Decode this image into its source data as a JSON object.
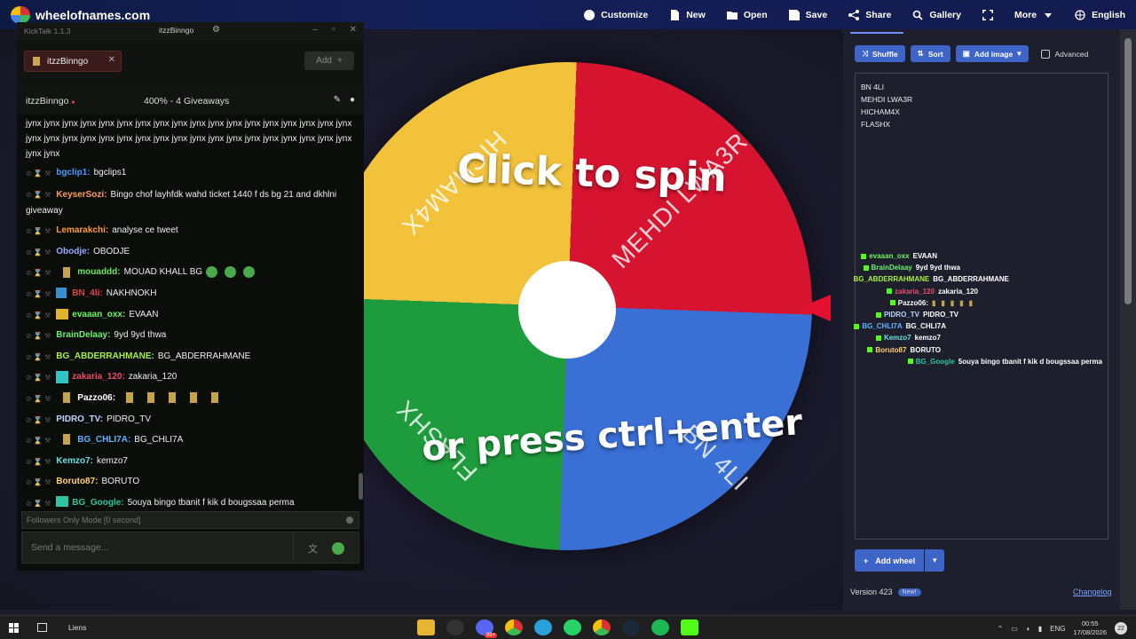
{
  "site": {
    "logo_text": "wheelofnames.com"
  },
  "topmenu": [
    {
      "label": "Customize",
      "icon": "palette-icon"
    },
    {
      "label": "New",
      "icon": "file-icon"
    },
    {
      "label": "Open",
      "icon": "folder-icon"
    },
    {
      "label": "Save",
      "icon": "save-icon"
    },
    {
      "label": "Share",
      "icon": "share-icon"
    },
    {
      "label": "Gallery",
      "icon": "search-icon"
    },
    {
      "label": "",
      "icon": "fullscreen-icon"
    },
    {
      "label": "More",
      "icon": "chevron-down-icon"
    },
    {
      "label": "English",
      "icon": "globe-icon"
    }
  ],
  "wheel": {
    "segments": [
      {
        "label": "MEHDI LWA3R",
        "color": "#d7142f"
      },
      {
        "label": "BN 4LI",
        "color": "#3a6fd6"
      },
      {
        "label": "FLASHX",
        "color": "#1e9b3d"
      },
      {
        "label": "HICHAM4X",
        "color": "#f2c23a"
      }
    ],
    "spin_top": "Click to spin",
    "spin_bottom": "or press ctrl+enter"
  },
  "panel": {
    "shuffle": "Shuffle",
    "sort": "Sort",
    "add_image": "Add image",
    "advanced": "Advanced",
    "entries": [
      "BN 4LI",
      "MEHDI LWA3R",
      "HICHAM4X",
      "FLASHX"
    ],
    "add_wheel": "Add wheel",
    "version": "Version 423",
    "new_badge": "New!",
    "changelog": "Changelog"
  },
  "overlay": [
    {
      "user": "evaaan_oxx",
      "msg": "EVAAN",
      "color": "#6cf55a"
    },
    {
      "user": "BrainDelaay",
      "msg": "9yd 9yd thwa",
      "color": "#6ff06f"
    },
    {
      "user": "BG_ABDERRAHMANE",
      "msg": "BG_ABDERRAHMANE",
      "color": "#a6f23a"
    },
    {
      "user": "zakaria_120",
      "msg": "zakaria_120",
      "color": "#ea4e6a"
    },
    {
      "user": "Pazzo06:",
      "msg": "",
      "color": "#ffffff"
    },
    {
      "user": "PIDRO_TV",
      "msg": "PIDRO_TV",
      "color": "#bcd4ff"
    },
    {
      "user": "BG_CHLI7A",
      "msg": "BG_CHLI7A",
      "color": "#5fb3ff"
    },
    {
      "user": "Kemzo7",
      "msg": "kemzo7",
      "color": "#66e0e0"
    },
    {
      "user": "Boruto87",
      "msg": "BORUTO",
      "color": "#ffd26b"
    },
    {
      "user": "BG_Google",
      "msg": "5ouya bingo tbanit f kik d bougssaa perma",
      "color": "#2ec4a0"
    }
  ],
  "kicktalk": {
    "title": "KickTalk 1.1.3",
    "channel_title": "itzzBinngo",
    "tab_label": "itzzBinngo",
    "add_label": "Add",
    "channel_name": "itzzBinngo",
    "giveaways": "400% - 4 Giveaways",
    "spam": "jynx jynx jynx jynx jynx jynx jynx jynx jynx jynx jynx jynx jynx jynx jynx jynx jynx jynx jynx jynx jynx jynx jynx jynx jynx jynx jynx jynx jynx jynx jynx jynx jynx jynx jynx jynx jynx jynx",
    "messages": [
      {
        "user": "bgclip1:",
        "text": "bgclips1",
        "color": "#4b9cff"
      },
      {
        "user": "KeyserSozi:",
        "text": "Bingo chof layhfdk wahd ticket 1440 f ds bg 21 and dkhlni giveaway",
        "color": "#ff9a5e"
      },
      {
        "user": "Lemarakchi:",
        "text": "analyse ce tweet",
        "color": "#ff9a3c"
      },
      {
        "user": "Obodje:",
        "text": "OBODJE",
        "color": "#9aa8ff"
      },
      {
        "user": "mouaddd:",
        "text": "MOUAD KHALL BG",
        "color": "#69e860"
      },
      {
        "user": "BN_4li:",
        "text": "NAKHNOKH",
        "color": "#e34444"
      },
      {
        "user": "evaaan_oxx:",
        "text": "EVAAN",
        "color": "#6cf55a"
      },
      {
        "user": "BrainDelaay:",
        "text": "9yd 9yd thwa",
        "color": "#6ff06f"
      },
      {
        "user": "BG_ABDERRAHMANE:",
        "text": "BG_ABDERRAHMANE",
        "color": "#a6f23a"
      },
      {
        "user": "zakaria_120:",
        "text": "zakaria_120",
        "color": "#ea4e6a"
      },
      {
        "user": "Pazzo06:",
        "text": "",
        "color": "#ffffff"
      },
      {
        "user": "PIDRO_TV:",
        "text": "PIDRO_TV",
        "color": "#bcd4ff"
      },
      {
        "user": "BG_CHLI7A:",
        "text": "BG_CHLI7A",
        "color": "#5fb3ff"
      },
      {
        "user": "Kemzo7:",
        "text": "kemzo7",
        "color": "#66e0e0"
      },
      {
        "user": "Boruto87:",
        "text": "BORUTO",
        "color": "#ffd26b"
      },
      {
        "user": "BG_Google:",
        "text": "5ouya bingo tbanit f kik d bougssaa perma",
        "color": "#2ec4a0"
      }
    ],
    "followers_mode": "Followers Only Mode [0 second]",
    "send_placeholder": "Send a message..."
  },
  "taskbar": {
    "liens": "Liens",
    "badge": "99+",
    "lang": "ENG",
    "time": "00:55",
    "date": "17/08/2026",
    "notif": "22"
  }
}
